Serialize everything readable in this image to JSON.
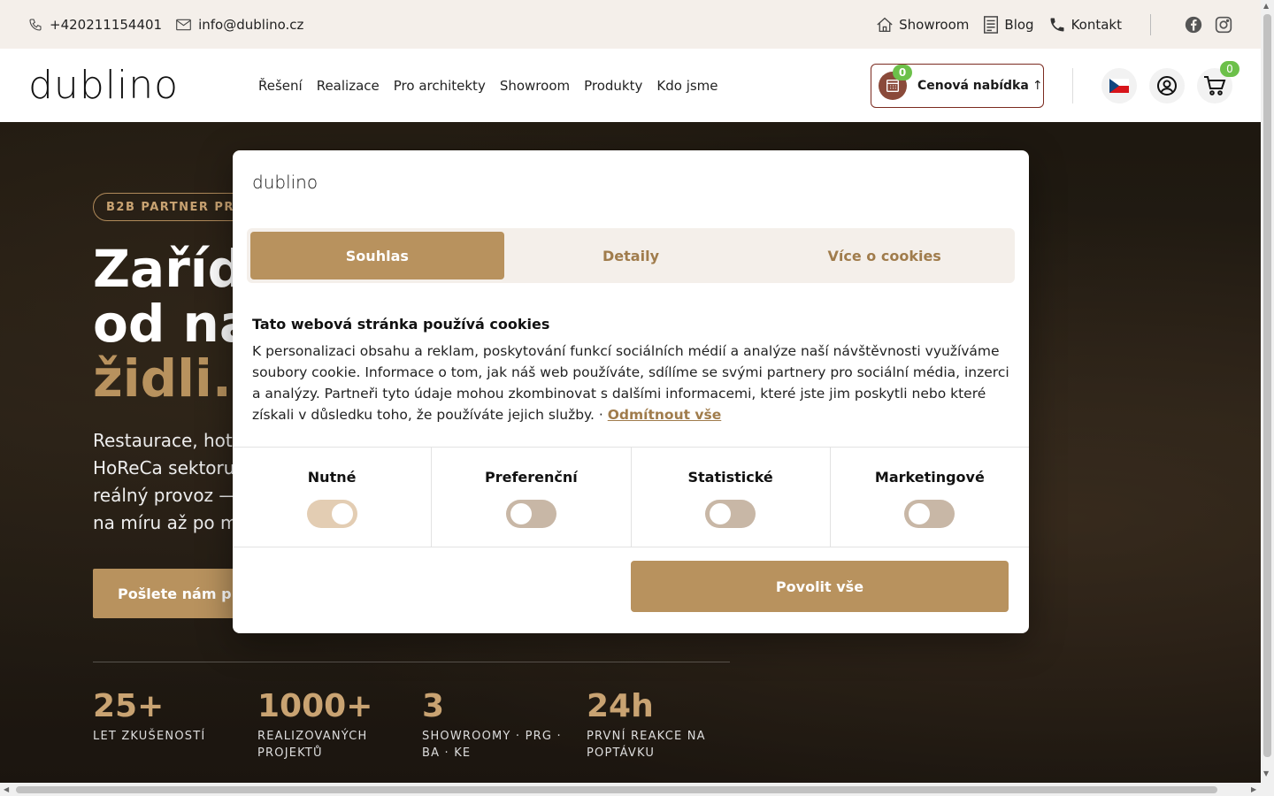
{
  "topbar": {
    "phone": "+420211154401",
    "email": "info@dublino.cz",
    "links": [
      "Showroom",
      "Blog",
      "Kontakt"
    ]
  },
  "header": {
    "logo": "dublino",
    "nav": [
      "Řešení",
      "Realizace",
      "Pro architekty",
      "Showroom",
      "Produkty",
      "Kdo jsme"
    ],
    "quote_label": "Cenová nabídka",
    "quote_count": "0",
    "cart_count": "0"
  },
  "hero": {
    "pill": "B2B PARTNER PRO",
    "title_line1": "Zaříd",
    "title_line2": "od ná",
    "title_line3": "židli.",
    "lead_line1": "Restaurace, hot",
    "lead_line2": "HoReCa sektoru",
    "lead_line3": "reálný provoz —",
    "lead_line4": "na míru až po m",
    "cta": "Pošlete nám p",
    "stats": [
      {
        "num": "25+",
        "label": "LET ZKUŠENOSTÍ"
      },
      {
        "num": "1000+",
        "label": "REALIZOVANÝCH PROJEKTŮ"
      },
      {
        "num": "3",
        "label": "SHOWROOMY · PRG · BA · KE"
      },
      {
        "num": "24h",
        "label": "PRVNÍ REAKCE NA POPTÁVKU"
      }
    ]
  },
  "cookie": {
    "logo": "dublino",
    "tabs": [
      "Souhlas",
      "Detaily",
      "Více o cookies"
    ],
    "heading": "Tato webová stránka používá cookies",
    "text": "K personalizaci obsahu a reklam, poskytování funkcí sociálních médií a analýze naší návštěvnosti využíváme soubory cookie. Informace o tom, jak náš web používáte, sdílíme se svými partnery pro sociální média, inzerci a analýzy. Partneři tyto údaje mohou zkombinovat s dalšími informacemi, které jste jim poskytli nebo které získali v důsledku toho, že používáte jejich služby. · ",
    "reject_all": "Odmítnout vše",
    "categories": [
      "Nutné",
      "Preferenční",
      "Statistické",
      "Marketingové"
    ],
    "allow_all": "Povolit vše"
  },
  "colors": {
    "accent": "#b8925e",
    "topbar_bg": "#f4efea",
    "badge": "#6cc04a"
  }
}
